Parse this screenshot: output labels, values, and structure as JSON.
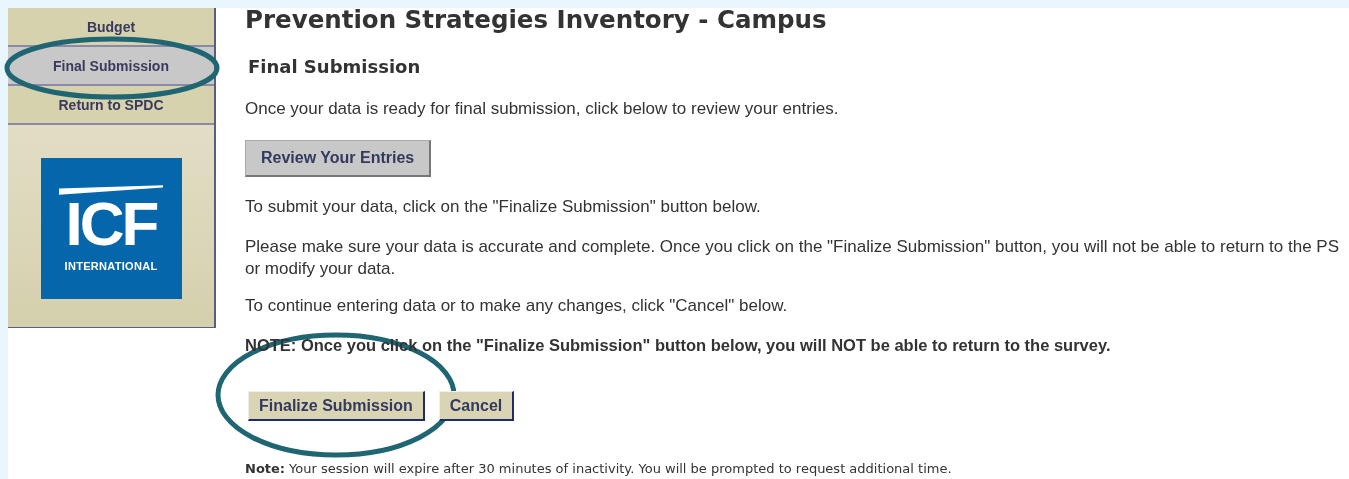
{
  "sidebar": {
    "items": [
      {
        "label": "Budget",
        "selected": false
      },
      {
        "label": "Final Submission",
        "selected": true
      },
      {
        "label": "Return to SPDC",
        "selected": false
      }
    ],
    "logo": {
      "text": "ICF",
      "subtitle": "INTERNATIONAL"
    }
  },
  "page_title": "Prevention Strategies Inventory - Campus",
  "section_title": "Final Submission",
  "intro": "Once your data is ready for final submission, click below to review your entries.",
  "review_button": "Review Your Entries",
  "instructions": [
    {
      "lines": [
        "To submit your data, click on the \"Finalize Submission\" button below."
      ]
    },
    {
      "lines": [
        "Please make sure your data is accurate and complete. Once you click on the \"Finalize Submission\" button, you will not be able to return to the PS",
        "or modify your data."
      ]
    },
    {
      "lines": [
        "To continue entering data or to make any changes, click \"Cancel\" below."
      ]
    }
  ],
  "warning": "NOTE: Once you click on the \"Finalize Submission\" button below, you will NOT be able to return to the survey.",
  "buttons": [
    "Finalize Submission",
    "Cancel"
  ],
  "footer_note": {
    "label": "Note:",
    "text": "Your session will expire after 30 minutes of inactivity. You will be prompted to request additional time."
  }
}
